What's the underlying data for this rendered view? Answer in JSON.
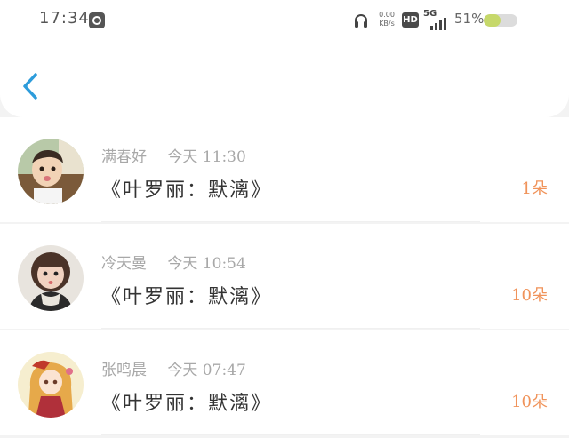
{
  "status_bar": {
    "time": "17:34",
    "net_speed_value": "0.00",
    "net_speed_unit": "KB/s",
    "hd_label": "HD",
    "network_type": "5G",
    "battery_percent_text": "51%",
    "battery_level": 0.51,
    "battery_color": "#c6d86a"
  },
  "nav": {
    "back_icon": "chevron-left-icon",
    "accent_color": "#2d9cdb"
  },
  "items": [
    {
      "name": "满春好",
      "time": "今天 11:30",
      "title": "《叶罗丽：默漓》",
      "count": "1朵",
      "avatar": "child-photo-avatar"
    },
    {
      "name": "冷天曼",
      "time": "今天 10:54",
      "title": "《叶罗丽：默漓》",
      "count": "10朵",
      "avatar": "girl-photo-avatar"
    },
    {
      "name": "张鸣晨",
      "time": "今天 07:47",
      "title": "《叶罗丽：默漓》",
      "count": "10朵",
      "avatar": "anime-girl-avatar"
    }
  ],
  "colors": {
    "count": "#f0935a",
    "name": "#a8a8a8",
    "title": "#333333"
  }
}
